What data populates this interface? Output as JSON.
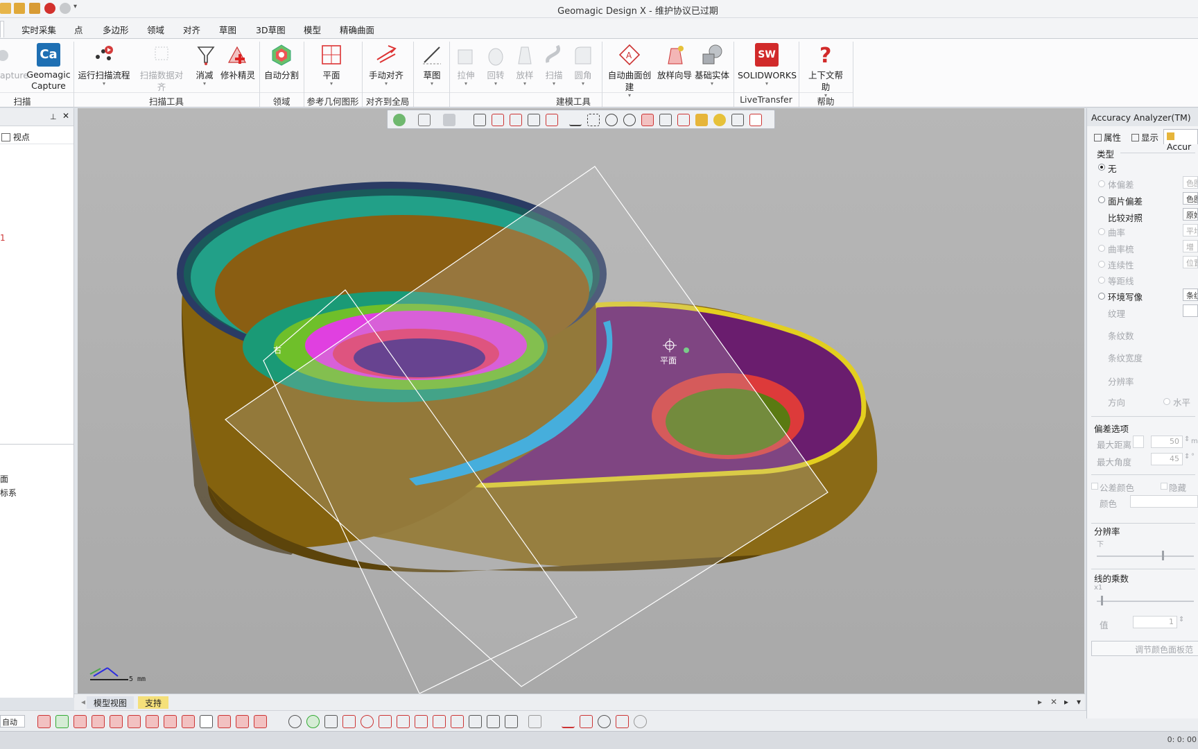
{
  "window": {
    "title": "Geomagic Design X - 维护协议已过期"
  },
  "menu": {
    "tabs": [
      "实时采集",
      "点",
      "多边形",
      "领域",
      "对齐",
      "草图",
      "3D草图",
      "模型",
      "精确曲面"
    ]
  },
  "ribbon": {
    "buttons": [
      {
        "label": "apture",
        "disabled": true
      },
      {
        "label": "Geomagic\nCapture",
        "disabled": false
      },
      {
        "label": "运行扫描流程",
        "disabled": false
      },
      {
        "label": "扫描数据对齐",
        "disabled": true
      },
      {
        "label": "消减",
        "disabled": false
      },
      {
        "label": "修补精灵",
        "disabled": false
      },
      {
        "label": "自动分割",
        "disabled": false
      },
      {
        "label": "平面",
        "disabled": false
      },
      {
        "label": "手动对齐",
        "disabled": false
      },
      {
        "label": "草图",
        "disabled": false
      },
      {
        "label": "拉伸",
        "disabled": true
      },
      {
        "label": "回转",
        "disabled": true
      },
      {
        "label": "放样",
        "disabled": true
      },
      {
        "label": "扫描",
        "disabled": true
      },
      {
        "label": "圆角",
        "disabled": true
      },
      {
        "label": "自动曲面创建",
        "disabled": false
      },
      {
        "label": "放样向导",
        "disabled": false
      },
      {
        "label": "基础实体",
        "disabled": false
      },
      {
        "label": "SOLIDWORKS",
        "disabled": false
      },
      {
        "label": "上下文帮助",
        "disabled": false
      }
    ],
    "groups": [
      "扫描",
      "扫描工具",
      "领域",
      "参考几何图形",
      "对齐到全局",
      "建模工具",
      "LiveTransfer",
      "帮助"
    ],
    "capture_icon_text": "Ca",
    "sw_icon_text": "SW"
  },
  "left_panel": {
    "item": "视点",
    "marker": "1",
    "bottom_items": [
      "面",
      "标系"
    ]
  },
  "viewport": {
    "plane_label": "平面",
    "right_label": "右",
    "scale_label": "5 mm"
  },
  "view_tabs": {
    "tabs": [
      "模型视图",
      "支持"
    ]
  },
  "bottom": {
    "mode_label": "自动"
  },
  "status": {
    "time": "0: 0: 00"
  },
  "right_panel": {
    "title": "Accuracy Analyzer(TM)",
    "tabs": [
      "属性",
      "显示",
      "Accur"
    ],
    "type_section": "类型",
    "options": [
      {
        "label": "无",
        "state": "on"
      },
      {
        "label": "体偏差",
        "state": "dis"
      },
      {
        "label": "面片偏差",
        "state": "off"
      },
      {
        "label": "比较对照",
        "state": "sub"
      },
      {
        "label": "曲率",
        "state": "dis"
      },
      {
        "label": "曲率梳",
        "state": "dis"
      },
      {
        "label": "连续性",
        "state": "dis"
      },
      {
        "label": "等距线",
        "state": "dis"
      },
      {
        "label": "环境写像",
        "state": "off"
      },
      {
        "label": "纹理",
        "state": "subdis"
      },
      {
        "label": "条纹数",
        "state": "subdis"
      },
      {
        "label": "条纹宽度",
        "state": "subdis"
      },
      {
        "label": "分辨率",
        "state": "subdis"
      },
      {
        "label": "方向",
        "state": "subdis"
      }
    ],
    "side_values": [
      "色图",
      "色图",
      "原始",
      "平均",
      "增",
      "位置",
      "条纹"
    ],
    "horizontal_label": "水平",
    "deviation_section": "偏差选项",
    "max_distance_label": "最大距离",
    "max_distance_value": "50",
    "max_distance_unit": "mm",
    "max_angle_label": "最大角度",
    "max_angle_value": "45",
    "max_angle_unit": "°",
    "tolerance_color_label": "公差颜色",
    "hide_label": "隐藏",
    "color_label": "颜色",
    "resolution_section": "分辨率",
    "resolution_low": "下",
    "line_multiplier_section": "线的乘数",
    "line_multiplier_mark": "x1",
    "value_label": "值",
    "value_value": "1",
    "adjust_button": "调节颜色面板范"
  }
}
